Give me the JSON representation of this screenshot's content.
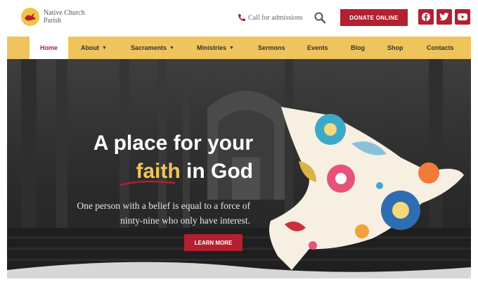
{
  "header": {
    "logo_text": "Native Church Parish",
    "call_label": "Call for admissions",
    "donate_label": "DONATE ONLINE",
    "social": [
      "facebook-icon",
      "twitter-icon",
      "youtube-icon"
    ]
  },
  "nav": {
    "items": [
      {
        "label": "Home",
        "active": true
      },
      {
        "label": "About",
        "dropdown": true
      },
      {
        "label": "Sacraments",
        "dropdown": true
      },
      {
        "label": "Ministries",
        "dropdown": true
      },
      {
        "label": "Sermons"
      },
      {
        "label": "Events"
      },
      {
        "label": "Blog"
      },
      {
        "label": "Shop"
      },
      {
        "label": "Contacts"
      }
    ]
  },
  "hero": {
    "title_line1": "A place for your",
    "title_faith": "faith",
    "title_rest": "in God",
    "subtitle_line1": "One person with a belief is equal to a force of",
    "subtitle_line2": "ninty-nine who only have interest.",
    "cta": "LEARN MORE"
  },
  "colors": {
    "accent": "#b3202f",
    "nav_bg": "#f0c45c",
    "faith": "#f0c45c"
  }
}
